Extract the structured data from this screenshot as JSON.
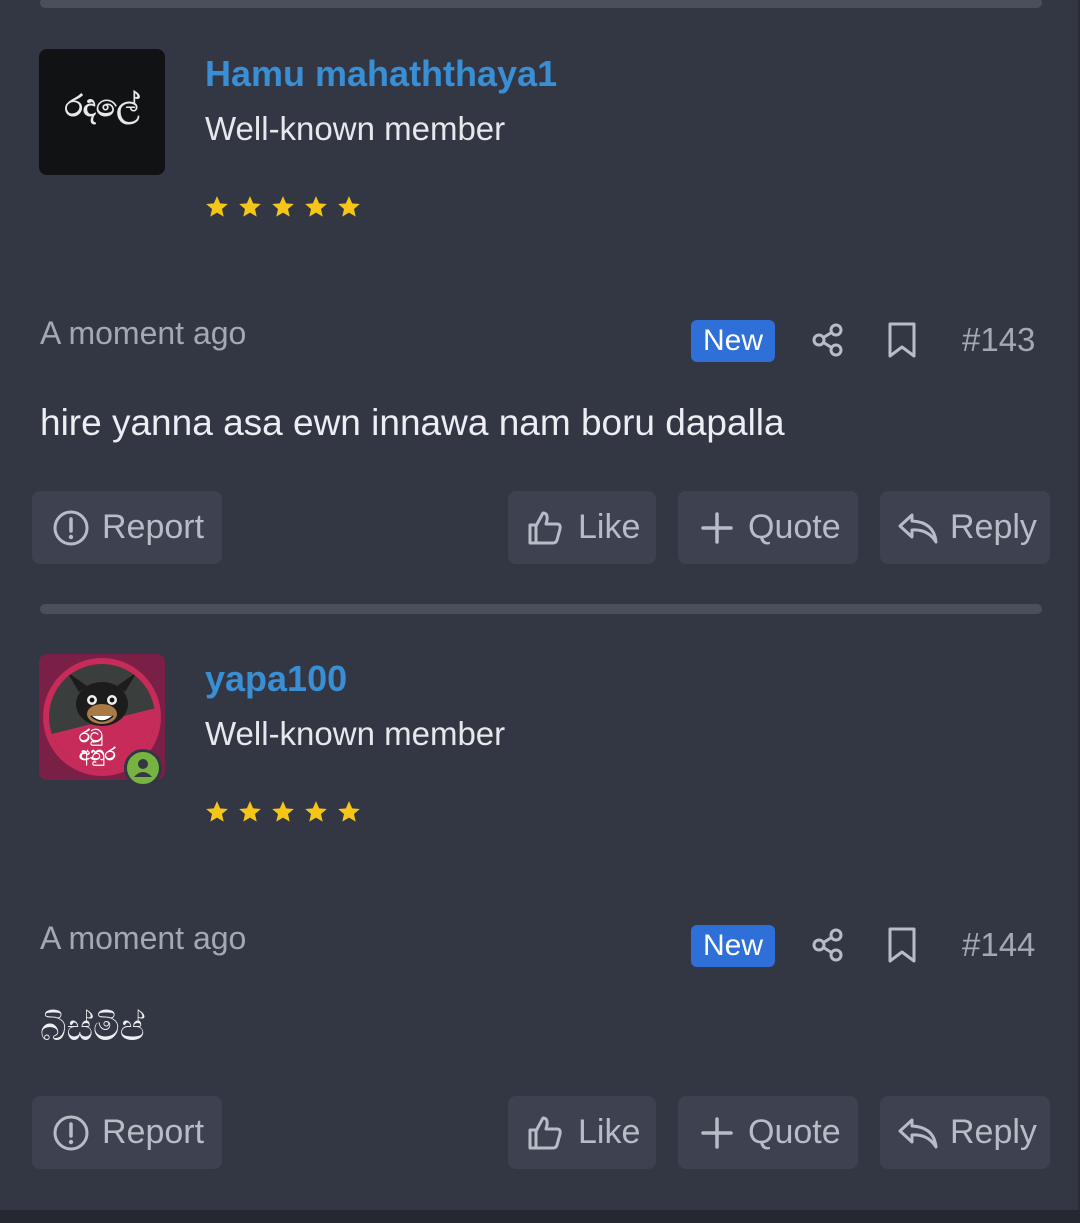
{
  "posts": [
    {
      "username": "Hamu mahaththaya1",
      "user_title": "Well-known member",
      "avatar_text": "රදලේ",
      "stars": 5,
      "timestamp": "A moment ago",
      "badge": "New",
      "post_number": "#143",
      "message": "hire yanna asa ewn innawa nam boru dapalla",
      "actions": {
        "report": "Report",
        "like": "Like",
        "quote": "Quote",
        "reply": "Reply"
      }
    },
    {
      "username": "yapa100",
      "user_title": "Well-known member",
      "avatar_text": "රටු අනුර",
      "stars": 5,
      "timestamp": "A moment ago",
      "badge": "New",
      "post_number": "#144",
      "message": "බිස්මිප්",
      "actions": {
        "report": "Report",
        "like": "Like",
        "quote": "Quote",
        "reply": "Reply"
      }
    }
  ],
  "colors": {
    "username": "#3a8fd4",
    "badge_new": "#2f6fd8",
    "star": "#f5c518",
    "online": "#76b340"
  },
  "icons": [
    "share-icon",
    "bookmark-icon",
    "report-icon",
    "thumbs-up-icon",
    "plus-icon",
    "reply-icon",
    "star-icon",
    "user-online-icon"
  ]
}
